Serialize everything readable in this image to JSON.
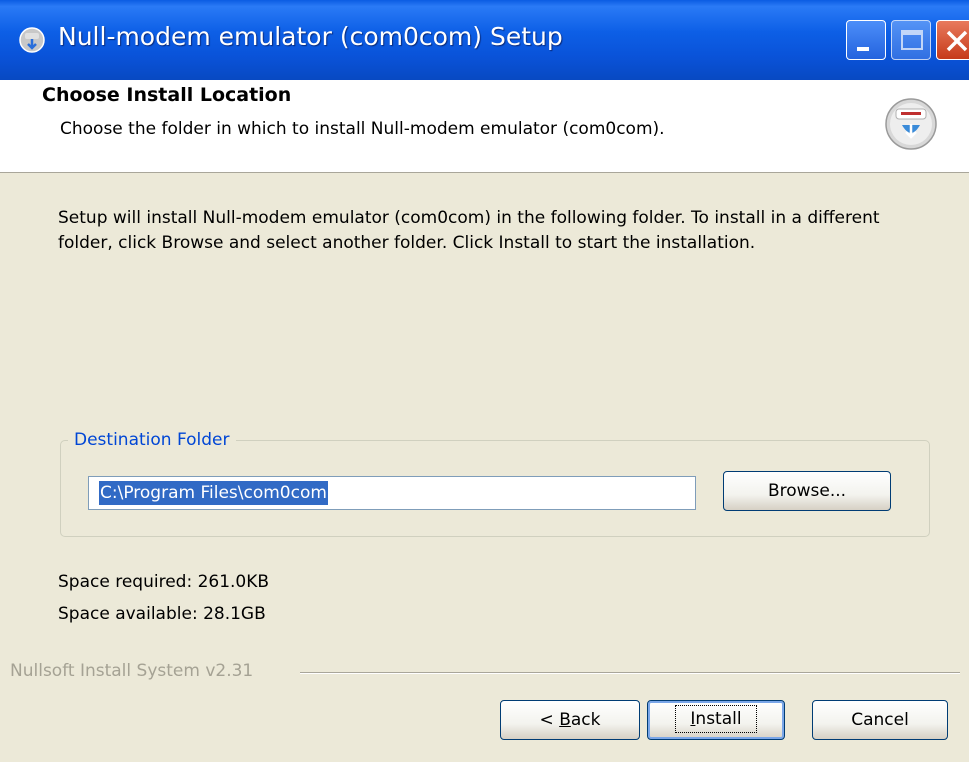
{
  "window": {
    "title": "Null-modem emulator (com0com) Setup"
  },
  "header": {
    "title": "Choose Install Location",
    "subtitle": "Choose the folder in which to install Null-modem emulator (com0com)."
  },
  "body": {
    "description": "Setup will install Null-modem emulator (com0com) in the following folder. To install in a different folder, click Browse and select another folder. Click Install to start the installation."
  },
  "destination": {
    "legend": "Destination Folder",
    "path": "C:\\Program Files\\com0com",
    "browse_label": "Browse..."
  },
  "space": {
    "required": "Space required: 261.0KB",
    "available": "Space available: 28.1GB"
  },
  "footer": {
    "branding": "Nullsoft Install System v2.31"
  },
  "buttons": {
    "back_prefix": "< ",
    "back_accel": "B",
    "back_rest": "ack",
    "install_accel": "I",
    "install_rest": "nstall",
    "cancel_label": "Cancel"
  },
  "icons": {
    "title_icon": "installer-icon",
    "header_logo": "nsis-logo-icon",
    "minimize": "minimize-icon",
    "maximize": "maximize-icon",
    "close": "close-icon"
  },
  "colors": {
    "titlebar": "#0a53d9",
    "legend": "#0046d5",
    "selection": "#316ac5",
    "close": "#c63a1a"
  }
}
